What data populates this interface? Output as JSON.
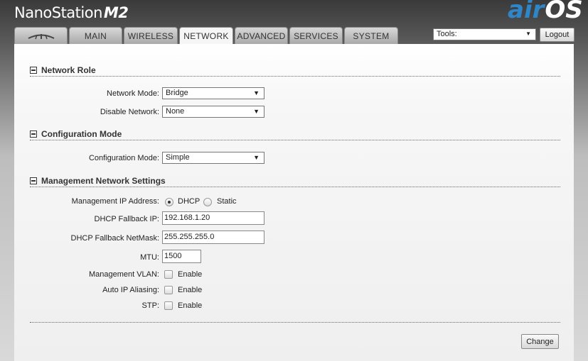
{
  "header": {
    "product": "NanoStation",
    "model": "M2",
    "brand_air": "air",
    "brand_os": "OS"
  },
  "tabs": [
    {
      "label": "",
      "icon": "ubiquiti-logo-icon"
    },
    {
      "label": "MAIN"
    },
    {
      "label": "WIRELESS"
    },
    {
      "label": "NETWORK",
      "active": true
    },
    {
      "label": "ADVANCED"
    },
    {
      "label": "SERVICES"
    },
    {
      "label": "SYSTEM"
    }
  ],
  "tools": {
    "selected": "Tools:"
  },
  "logout_label": "Logout",
  "network_role": {
    "title": "Network Role",
    "network_mode_label": "Network Mode:",
    "network_mode_value": "Bridge",
    "disable_network_label": "Disable Network:",
    "disable_network_value": "None"
  },
  "configuration_mode": {
    "title": "Configuration Mode",
    "label": "Configuration Mode:",
    "value": "Simple"
  },
  "management": {
    "title": "Management Network Settings",
    "ip_address_label": "Management IP Address:",
    "dhcp_label": "DHCP",
    "static_label": "Static",
    "fallback_ip_label": "DHCP Fallback IP:",
    "fallback_ip_value": "192.168.1.20",
    "fallback_mask_label": "DHCP Fallback NetMask:",
    "fallback_mask_value": "255.255.255.0",
    "mtu_label": "MTU:",
    "mtu_value": "1500",
    "vlan_label": "Management VLAN:",
    "vlan_enable": "Enable",
    "aliasing_label": "Auto IP Aliasing:",
    "aliasing_enable": "Enable",
    "stp_label": "STP:",
    "stp_enable": "Enable"
  },
  "change_label": "Change",
  "colors": {
    "brand_blue": "#2e86c9"
  }
}
